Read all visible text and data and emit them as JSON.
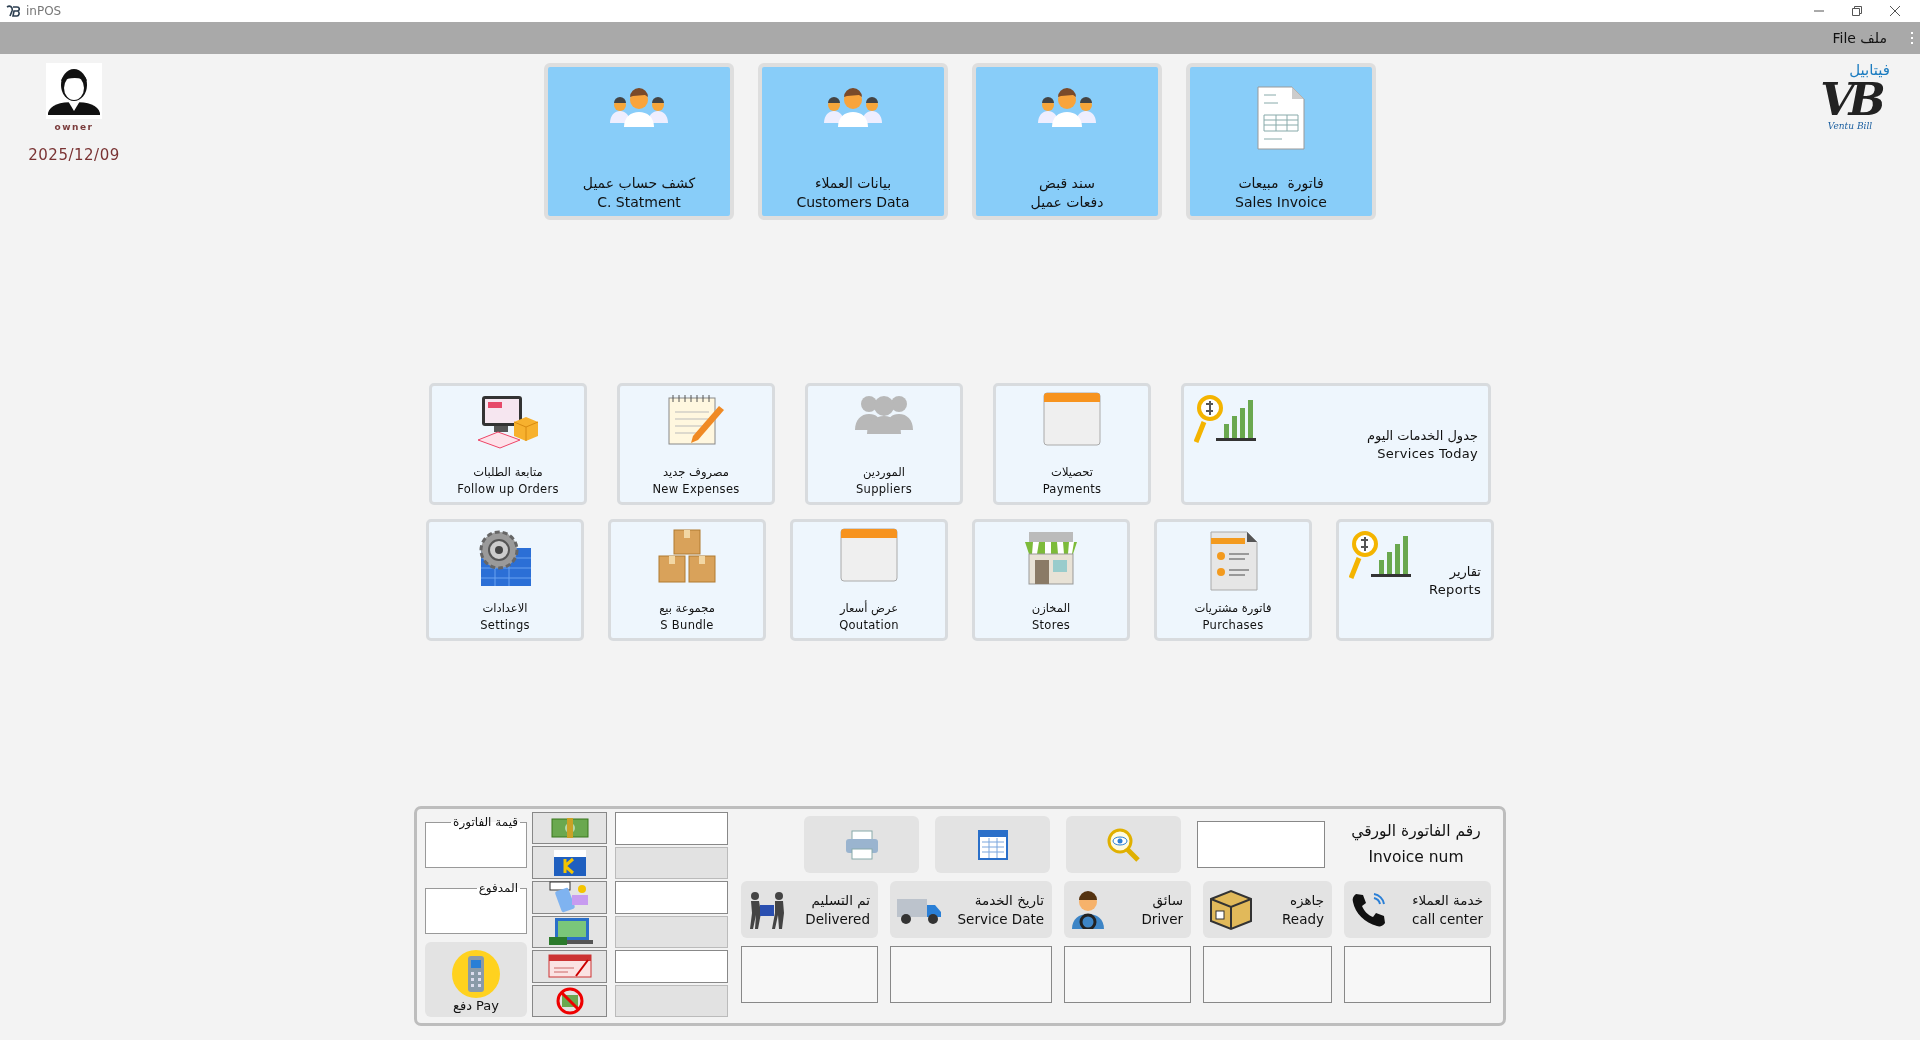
{
  "window": {
    "title": "inPOS"
  },
  "menu_bar": {
    "label": "File ملف"
  },
  "user": {
    "name": "owner",
    "date": "2025/12/09"
  },
  "logo": {
    "arabic": "فيتابيل",
    "letters": "VB",
    "tagline": "Ventu Bill"
  },
  "top_tiles": [
    {
      "lines": [
        "فاتورة  مبيعات",
        "Sales Invoice"
      ]
    },
    {
      "lines": [
        "سند قبض",
        "دفعات عميل"
      ]
    },
    {
      "lines": [
        "بيانات العملاء",
        "Customers Data"
      ]
    },
    {
      "lines": [
        "كشف حساب عميل",
        "C. Statment"
      ]
    }
  ],
  "tile_rows": [
    {
      "tiles": [
        {
          "kind": "banner",
          "lines": [
            "جدول الخدمات اليوم",
            "Services Today"
          ]
        },
        {
          "kind": "stacked",
          "lines": [
            "تحصيلات",
            "Payments"
          ]
        },
        {
          "kind": "stacked",
          "lines": [
            "الموردين",
            "Suppliers"
          ]
        },
        {
          "kind": "stacked",
          "lines": [
            "مصروف جديد",
            "New Expenses"
          ]
        },
        {
          "kind": "stacked",
          "lines": [
            "متابعة الطلبات",
            "Follow up Orders"
          ]
        }
      ]
    },
    {
      "tiles": [
        {
          "kind": "side",
          "lines": [
            "تقارير",
            "Reports"
          ]
        },
        {
          "kind": "stacked",
          "lines": [
            "فاتورة مشتريات",
            "Purchases"
          ]
        },
        {
          "kind": "stacked",
          "lines": [
            "المخازن",
            "Stores"
          ]
        },
        {
          "kind": "stacked",
          "lines": [
            "عرض أسعار",
            "Qoutation"
          ]
        },
        {
          "kind": "stacked",
          "lines": [
            "مجموعة بيع",
            "S Bundle"
          ]
        },
        {
          "kind": "stacked",
          "lines": [
            "الاعدادات",
            "Settings"
          ]
        }
      ]
    }
  ],
  "panel": {
    "invoice_value": {
      "label": "قيمة الفاتورة"
    },
    "paid": {
      "label": "المدفوع"
    },
    "pay_button": {
      "label": "دفع Pay"
    },
    "payment_fields": [
      {
        "disabled": false
      },
      {
        "disabled": true
      },
      {
        "disabled": false
      },
      {
        "disabled": true
      },
      {
        "disabled": false
      },
      {
        "disabled": true
      }
    ],
    "invoice_num": {
      "lines": [
        "رقم الفاتورة الورقي",
        "Invoice num"
      ]
    },
    "status_buttons": [
      {
        "lines": [
          "خدمة العملاء",
          "call center"
        ]
      },
      {
        "lines": [
          "جاهزه",
          "Ready"
        ]
      },
      {
        "lines": [
          "سائق",
          "Driver"
        ]
      },
      {
        "lines": [
          "تاريخ الخدمة",
          "Service Date"
        ]
      },
      {
        "lines": [
          "تم التسليم",
          "Delivered"
        ]
      }
    ]
  }
}
